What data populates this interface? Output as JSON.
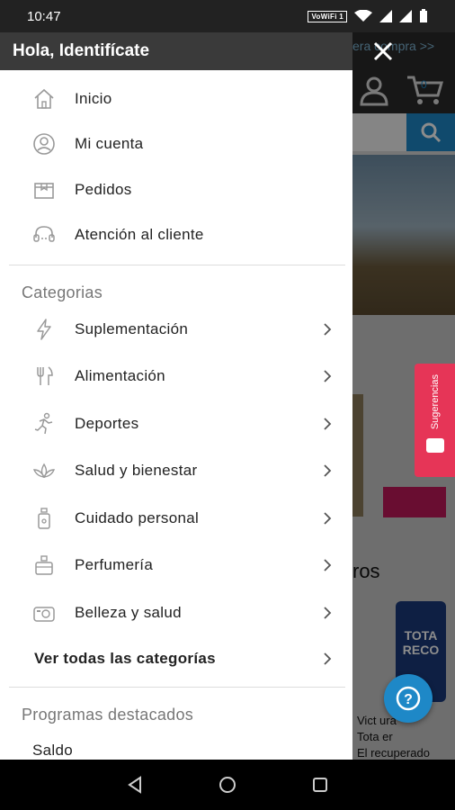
{
  "status": {
    "time": "10:47",
    "wifi_badge": "VoWiFi 1"
  },
  "drawer": {
    "greeting": "Hola, Identifícate",
    "main_items": [
      {
        "label": "Inicio",
        "icon": "home-icon"
      },
      {
        "label": "Mi cuenta",
        "icon": "account-icon"
      },
      {
        "label": "Pedidos",
        "icon": "orders-icon"
      },
      {
        "label": "Atención al cliente",
        "icon": "headset-icon"
      }
    ],
    "categories_title": "Categorias",
    "categories": [
      {
        "label": "Suplementación",
        "icon": "bolt-icon"
      },
      {
        "label": "Alimentación",
        "icon": "cutlery-icon"
      },
      {
        "label": "Deportes",
        "icon": "runner-icon"
      },
      {
        "label": "Salud y bienestar",
        "icon": "lotus-icon"
      },
      {
        "label": "Cuidado personal",
        "icon": "bottle-icon"
      },
      {
        "label": "Perfumería",
        "icon": "perfume-icon"
      },
      {
        "label": "Belleza y salud",
        "icon": "camera-icon"
      }
    ],
    "all_categories": "Ver todas las categorías",
    "programs_title": "Programas destacados",
    "programs": [
      {
        "label": "Saldo"
      }
    ]
  },
  "background": {
    "promo_text": "era compra >>",
    "cart_count": "0",
    "section_title": "ros",
    "product_lines": [
      "Vict ura",
      "Tota er",
      "El recuperado"
    ],
    "product_badge": [
      "TOTA",
      "RECO"
    ]
  },
  "feedback_tab": {
    "label": "Sugerencias"
  },
  "help_fab": {
    "label": "?"
  },
  "colors": {
    "accent": "#1e88c7",
    "header": "#3a3a3a",
    "feedback": "#e63557"
  }
}
